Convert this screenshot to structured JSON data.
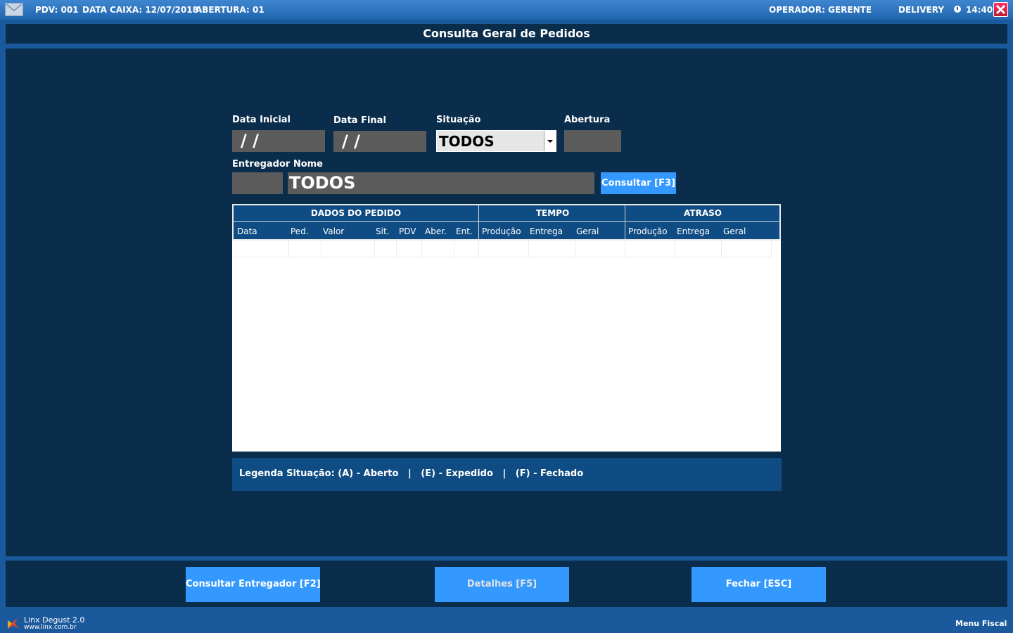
{
  "topbar": {
    "pdv": "PDV: 001",
    "data_caixa": "DATA CAIXA: 12/07/2018",
    "abertura": "ABERTURA: 01",
    "operador": "OPERADOR:  GERENTE",
    "mode": "DELIVERY",
    "time": "14:40"
  },
  "window": {
    "title": "Consulta Geral de Pedidos"
  },
  "filters": {
    "data_inicial_label": "Data Inicial",
    "data_inicial_value": "/  /",
    "data_final_label": "Data Final",
    "data_final_value": "/  /",
    "situacao_label": "Situação",
    "situacao_value": "TODOS",
    "abertura_label": "Abertura",
    "abertura_value": "",
    "entregador_label": "Entregador Nome",
    "entregador_code": "",
    "entregador_nome": "TODOS",
    "consultar_label": "Consultar [F3]"
  },
  "grid": {
    "groups": [
      "DADOS DO PEDIDO",
      "TEMPO",
      "ATRASO"
    ],
    "columns": [
      "Data",
      "Ped.",
      "Valor",
      "Sit.",
      "PDV",
      "Aber.",
      "Ent.",
      "Produção",
      "Entrega",
      "Geral",
      "Produção",
      "Entrega",
      "Geral"
    ],
    "rows": []
  },
  "legend": {
    "text": "Legenda Situação: (A) - Aberto   |   (E) - Expedido   |   (F) - Fechado"
  },
  "actions": {
    "consultar_entregador": "Consultar Entregador [F2]",
    "detalhes": "Detalhes [F5]",
    "fechar": "Fechar [ESC]"
  },
  "footer": {
    "product": "Linx Degust 2.0",
    "url": "www.linx.com.br",
    "menu": "Menu Fiscal"
  }
}
